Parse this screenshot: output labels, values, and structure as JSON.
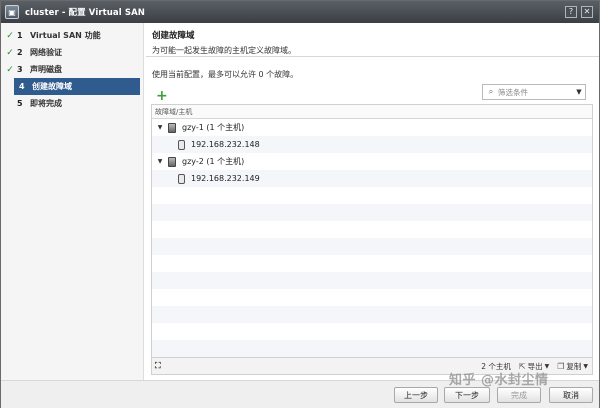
{
  "window": {
    "icon": "cluster-icon",
    "title": "cluster - 配置 Virtual SAN"
  },
  "sidebar": {
    "items": [
      {
        "num": "1",
        "label": "Virtual SAN 功能",
        "checked": true
      },
      {
        "num": "2",
        "label": "网络验证",
        "checked": true
      },
      {
        "num": "3",
        "label": "声明磁盘",
        "checked": true
      },
      {
        "num": "4",
        "label": "创建故障域",
        "checked": false
      },
      {
        "num": "5",
        "label": "即将完成",
        "checked": false
      }
    ]
  },
  "header": {
    "title": "创建故障域",
    "description": "为可能一起发生故障的主机定义故障域。"
  },
  "main": {
    "subtitle": "使用当前配置，最多可以允许 0 个故障。",
    "filter": {
      "placeholder": "筛选条件"
    },
    "grid": {
      "column_header": "故障域/主机",
      "rows": [
        {
          "type": "domain",
          "label": "gzy-1 (1 个主机)"
        },
        {
          "type": "host",
          "label": "192.168.232.148"
        },
        {
          "type": "domain",
          "label": "gzy-2 (1 个主机)"
        },
        {
          "type": "host",
          "label": "192.168.232.149"
        }
      ]
    },
    "footer": {
      "count": "2 个主机",
      "export_label": "导出",
      "copy_label": "复制"
    }
  },
  "buttons": {
    "back": "上一步",
    "next": "下一步",
    "finish": "完成",
    "cancel": "取消"
  },
  "watermark": "知乎 @水封尘情"
}
